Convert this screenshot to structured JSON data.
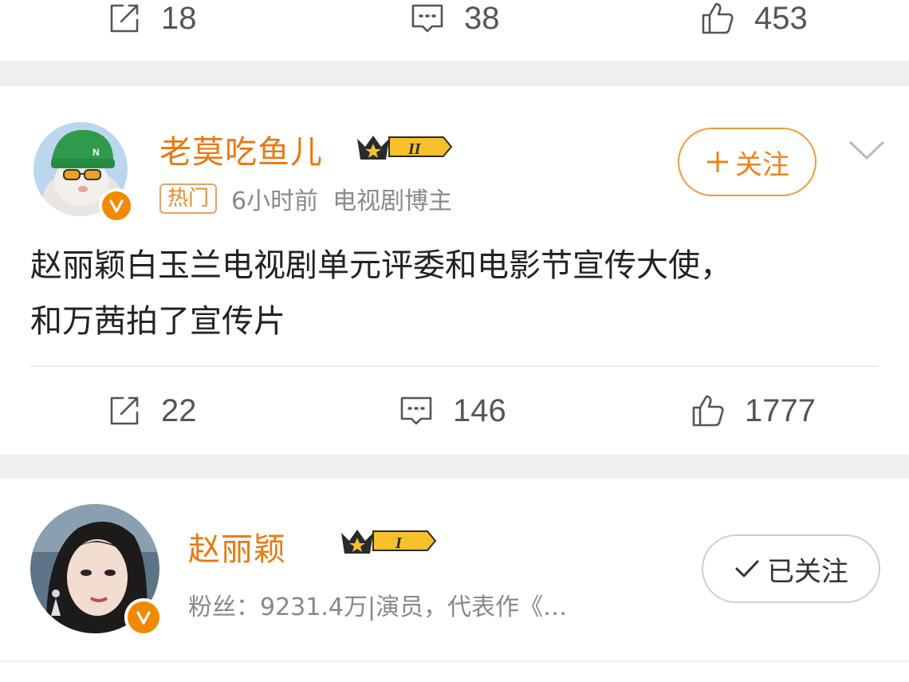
{
  "post1": {
    "actions": {
      "repost_count": "18",
      "comment_count": "38",
      "like_count": "453"
    }
  },
  "post2": {
    "user": {
      "name": "老莫吃鱼儿",
      "vip_level": "II"
    },
    "meta": {
      "hot_tag": "热门",
      "time": "6小时前",
      "role": "电视剧博主"
    },
    "follow_label": "关注",
    "text_line1": "赵丽颖白玉兰电视剧单元评委和电影节宣传大使，",
    "text_line2": "和万茜拍了宣传片",
    "actions": {
      "repost_count": "22",
      "comment_count": "146",
      "like_count": "1777"
    }
  },
  "profile_card": {
    "name": "赵丽颖",
    "vip_level": "I",
    "fans_line": "粉丝：9231.4万|演员，代表作《…",
    "followed_label": "已关注"
  },
  "colors": {
    "accent": "#ea7812",
    "follow_border": "#f29b3b",
    "badge": "#f28a00",
    "gap": "#efefef"
  },
  "icons": [
    "repost-icon",
    "comment-icon",
    "like-icon",
    "chevron-down-icon",
    "verified-icon",
    "vip-crown-icon",
    "plus-icon",
    "check-icon"
  ]
}
